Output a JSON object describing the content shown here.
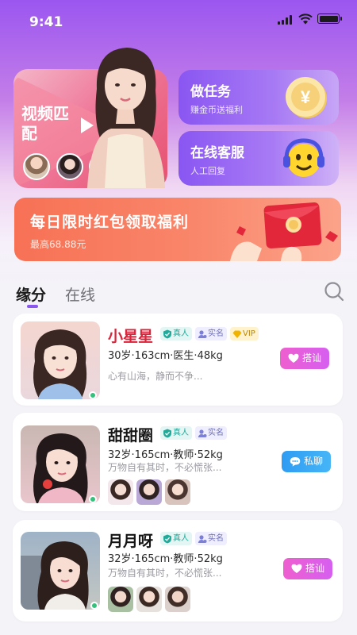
{
  "status_bar": {
    "time": "9:41"
  },
  "top_cards": {
    "video_match": {
      "title": "视频匹配"
    },
    "task": {
      "title": "做任务",
      "subtitle": "赚金币送福利"
    },
    "service": {
      "title": "在线客服",
      "subtitle": "人工回复"
    }
  },
  "banner": {
    "title": "每日限时红包领取福利",
    "subtitle": "最高68.88元"
  },
  "tabs": [
    {
      "label": "缘分",
      "active": true
    },
    {
      "label": "在线",
      "active": false
    }
  ],
  "badges": {
    "real": "真人",
    "verified": "实名",
    "vip": "VIP"
  },
  "profiles": [
    {
      "name": "小星星",
      "info": "30岁·163cm·医生·48kg",
      "desc": "心有山海，静而不争...",
      "action": "搭讪",
      "vip": true,
      "online": true
    },
    {
      "name": "甜甜圈",
      "info": "32岁·165cm·教师·52kg",
      "desc": "万物自有其时，不必慌张...",
      "action": "私聊",
      "vip": false,
      "online": true
    },
    {
      "name": "月月呀",
      "info": "32岁·165cm·教师·52kg",
      "desc": "万物自有其时，不必慌张...",
      "action": "搭讪",
      "vip": false,
      "online": true
    }
  ],
  "colors": {
    "accent": "#8a58ef",
    "online": "#33c17b",
    "pink_button": "#e35fdf",
    "blue_button": "#3aa8f4"
  }
}
